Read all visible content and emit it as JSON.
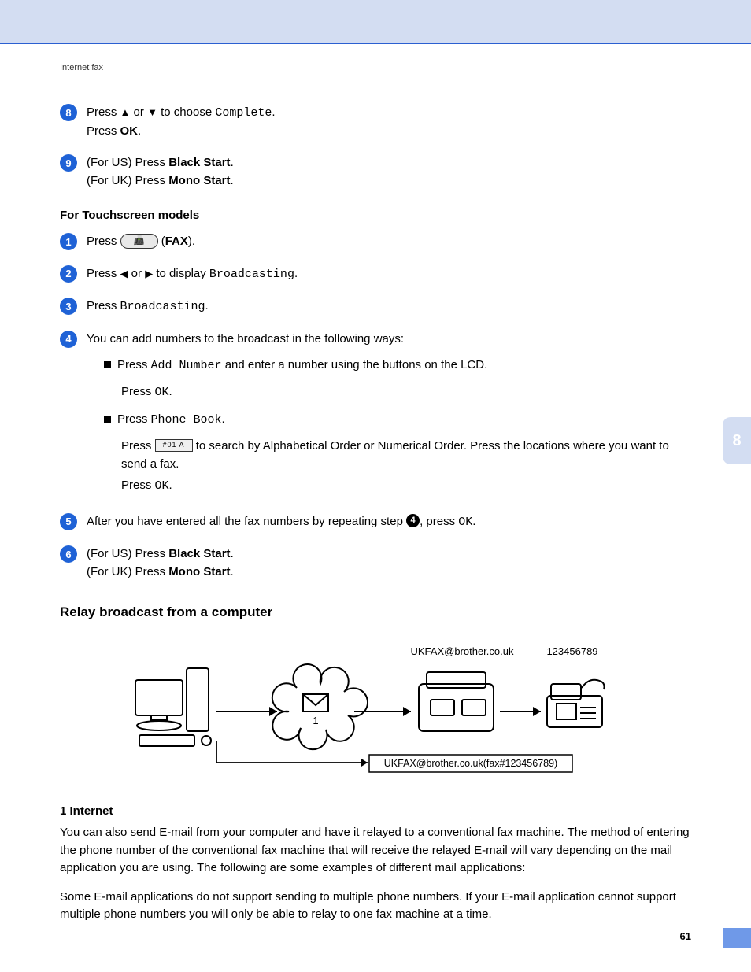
{
  "header": "Internet fax",
  "side_tab": "8",
  "page_number": "61",
  "steps_top": [
    {
      "n": "8",
      "pre": "Press ",
      "arrow1": "▲",
      "mid": " or ",
      "arrow2": "▼",
      "post": " to choose ",
      "code": "Complete",
      "tail": ".",
      "line2_a": "Press ",
      "line2_b": "OK",
      "line2_c": "."
    },
    {
      "n": "9",
      "us_a": "(For US) Press ",
      "us_b": "Black Start",
      "us_c": ".",
      "uk_a": "(For UK) Press ",
      "uk_b": "Mono Start",
      "uk_c": "."
    }
  ],
  "touch_heading": "For Touchscreen models",
  "touch_steps": {
    "s1": {
      "n": "1",
      "a": "Press ",
      "b": " (",
      "c": "FAX",
      "d": ")."
    },
    "s2": {
      "n": "2",
      "a": "Press ",
      "arrow1": "◀",
      "mid": " or ",
      "arrow2": "▶",
      "b": " to display ",
      "code": "Broadcasting",
      "c": "."
    },
    "s3": {
      "n": "3",
      "a": "Press ",
      "code": "Broadcasting",
      "b": "."
    },
    "s4": {
      "n": "4",
      "intro": "You can add numbers to the broadcast in the following ways:",
      "b1_a": "Press ",
      "b1_code": "Add Number",
      "b1_b": " and enter a number using the buttons on the LCD.",
      "b1_c": "Press ",
      "b1_ok": "OK",
      "b1_d": ".",
      "b2_a": "Press ",
      "b2_code": "Phone Book",
      "b2_b": ".",
      "b2_c": "Press ",
      "b2_d": " to search by Alphabetical Order or Numerical Order. Press the locations where you want to send a fax.",
      "b2_e": "Press ",
      "b2_ok": "OK",
      "b2_f": "."
    },
    "s5": {
      "n": "5",
      "a": "After you have entered all the fax numbers by repeating step ",
      "ref": "4",
      "b": ", press ",
      "ok": "OK",
      "c": "."
    },
    "s6": {
      "n": "6",
      "us_a": "(For US) Press ",
      "us_b": "Black Start",
      "us_c": ".",
      "uk_a": "(For UK) Press ",
      "uk_b": "Mono Start",
      "uk_c": "."
    }
  },
  "relay_title": "Relay broadcast from a computer",
  "diagram": {
    "email": "UKFAX@brother.co.uk",
    "number": "123456789",
    "cloud_label": "1",
    "caption": "UKFAX@brother.co.uk(fax#123456789)"
  },
  "legend": "1   Internet",
  "para1": "You can also send E-mail from your computer and have it relayed to a conventional fax machine. The method of entering the phone number of the conventional fax machine that will receive the relayed E-mail will vary depending on the mail application you are using. The following are some examples of different mail applications:",
  "para2": "Some E-mail applications do not support sending to multiple phone numbers. If your E-mail application cannot support multiple phone numbers you will only be able to relay to one fax machine at a time."
}
